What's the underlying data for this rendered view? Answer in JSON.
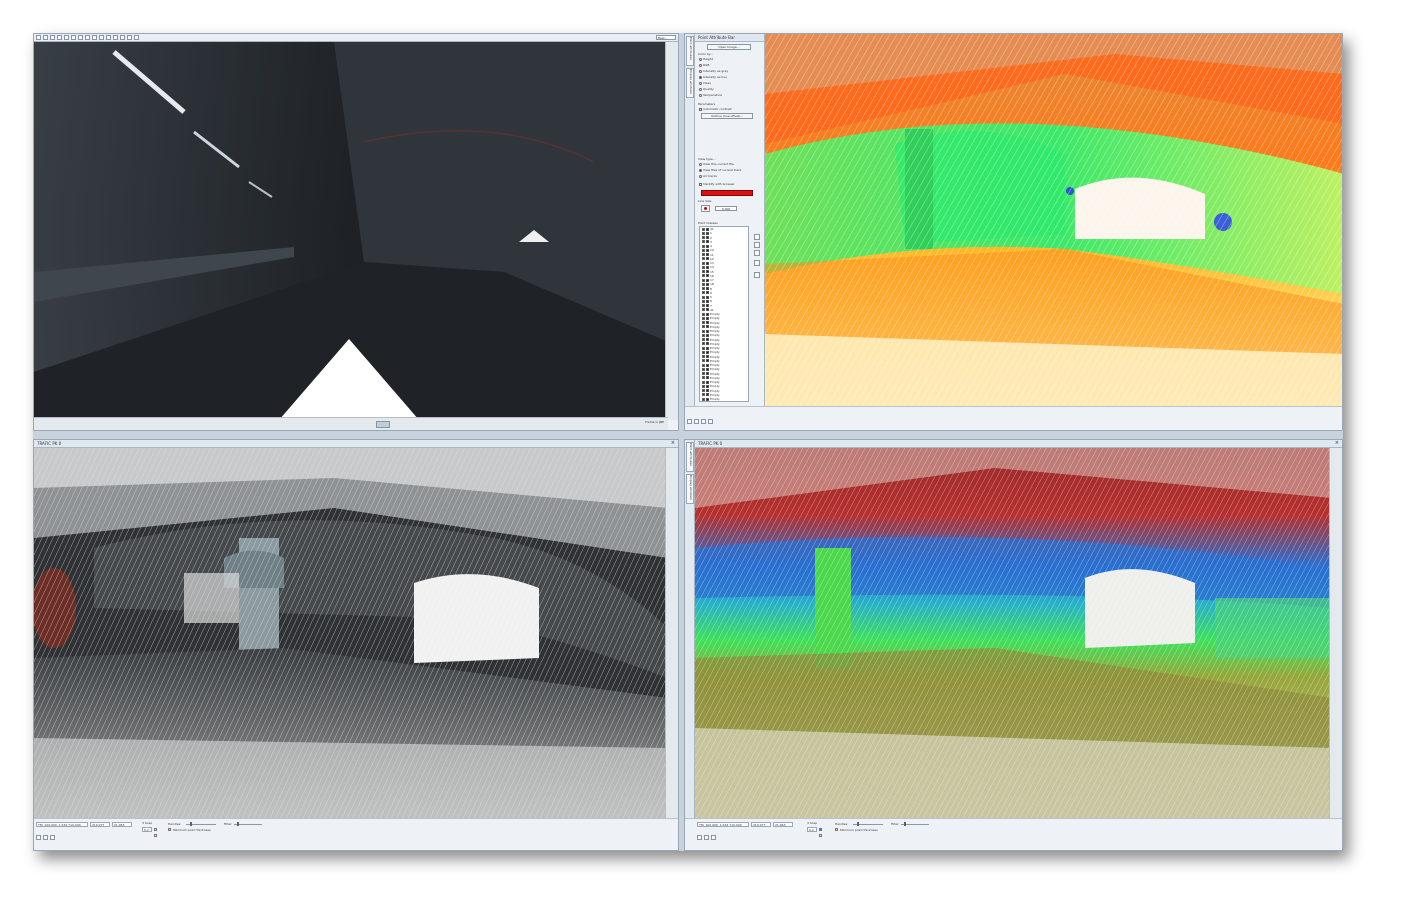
{
  "colors": {
    "panorama_bg": "#22262b",
    "cloud_dark_bg": "#2b2e2f",
    "window_chrome": "#dfe7f0",
    "attribute_red_bar": "#e01010"
  },
  "tl": {
    "zoom_dropdown": "Best...",
    "status_text": "Frame in JBE"
  },
  "tr": {
    "tab_labels": [
      "Point attributes",
      "Display windows"
    ],
    "panel_title": "Point Attribute Bar",
    "open_image_button": "Open Image...",
    "color_by_label": "Color by...",
    "color_by_options": [
      {
        "label": "Height",
        "on": false
      },
      {
        "label": "RGB",
        "on": false
      },
      {
        "label": "Intensity as gray",
        "on": false
      },
      {
        "label": "Intensity as hue",
        "on": true
      },
      {
        "label": "Class",
        "on": false
      },
      {
        "label": "Quality",
        "on": false
      },
      {
        "label": "Temperature",
        "on": false
      }
    ],
    "parameters_label": "Parameters",
    "automatic_contrast": "Automatic contrast",
    "outline_button": "Outline (hue offset)...",
    "view_type_label": "View type...",
    "view_type_options": [
      {
        "label": "View this current file",
        "on": false
      },
      {
        "label": "View files of current track",
        "on": true
      },
      {
        "label": "All tracks",
        "on": false
      }
    ],
    "identify_label": "Identify with browser",
    "line_size_label": "Line Size",
    "line_size_value": "0.000",
    "point_classes_label": "Point Classes",
    "class_items": [
      "31",
      "1",
      "2",
      "3",
      "4",
      "10",
      "11",
      "12",
      "13",
      "14",
      "15",
      "16",
      "17",
      "18",
      "8",
      "9",
      "5",
      "6",
      "7",
      "41",
      "Empty",
      "Empty",
      "Empty",
      "Empty",
      "Empty",
      "Empty",
      "Empty",
      "Empty",
      "Empty",
      "Empty",
      "Empty",
      "Empty",
      "Empty",
      "Empty",
      "Empty",
      "Empty",
      "Empty",
      "Empty",
      "Empty",
      "Empty",
      "Empty",
      "Empty",
      "Empty",
      "Empty",
      "Empty"
    ]
  },
  "bl": {
    "window_title": "TRAFIC PK 0",
    "tab_labels": [
      "Point attributes",
      "Display windows"
    ],
    "coords": "TM: 100.000, 1 634 710.000",
    "field_b": "210.977",
    "field_c": "21.963",
    "group_label": "3 Scap",
    "field_d": "0.2",
    "handles_label": "Handles:",
    "filter_label": "Filter:",
    "min_point_label": "Minimum point thickness"
  },
  "br": {
    "window_title": "TRAFIC PK 0",
    "tab_labels": [
      "Point attributes",
      "Display windows"
    ],
    "coords": "TM: 100.000, 1 634 710.000",
    "field_b": "210.977",
    "field_c": "21.963",
    "group_label": "3 Scap",
    "field_d": "0.2",
    "handles_label": "Handles:",
    "filter_label": "Filter:",
    "min_point_label": "Minimum point thickness"
  }
}
